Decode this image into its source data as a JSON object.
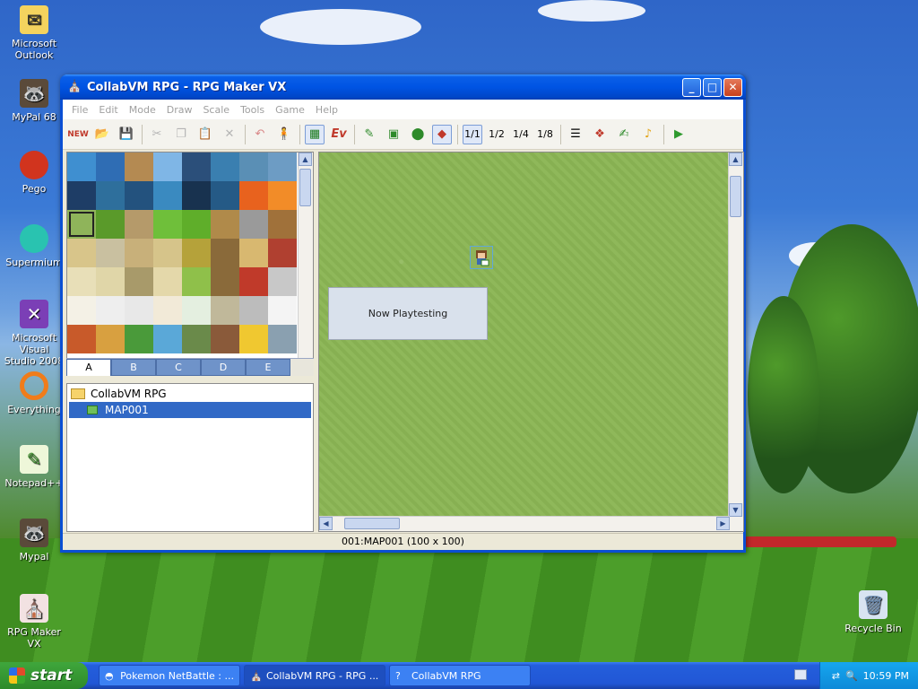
{
  "desktop": {
    "icons": [
      {
        "label": "Microsoft\nOutlook",
        "glyph": "✉",
        "color": "#f4d35e"
      },
      {
        "label": "MyPal 68",
        "glyph": "🦝",
        "color": "#ffffff"
      },
      {
        "label": "Pego",
        "glyph": "●",
        "color": "#d1341e"
      },
      {
        "label": "Supermium",
        "glyph": "●",
        "color": "#29c3b0"
      },
      {
        "label": "Microsoft Visual\nStudio 2008",
        "glyph": "✕",
        "color": "#ffffff"
      },
      {
        "label": "Everything",
        "glyph": "◯",
        "color": "#f07c1a"
      },
      {
        "label": "Notepad++",
        "glyph": "✎",
        "color": "#8bd15a"
      },
      {
        "label": "Mypal",
        "glyph": "🦝",
        "color": "#ffffff"
      },
      {
        "label": "RPG Maker VX",
        "glyph": "⛪",
        "color": "#ffffff"
      }
    ],
    "recycle_bin": "Recycle Bin"
  },
  "window": {
    "title": "CollabVM RPG - RPG Maker VX",
    "menu": [
      "File",
      "Edit",
      "Mode",
      "Draw",
      "Scale",
      "Tools",
      "Game",
      "Help"
    ],
    "toolbar_icons": [
      "new-project-icon",
      "open-project-icon",
      "save-icon",
      "cut-icon",
      "copy-icon",
      "paste-icon",
      "delete-icon",
      "undo-icon",
      "tileset-mode-icon",
      "map-layer-icon",
      "event-layer-icon",
      "pencil-icon",
      "rectangle-icon",
      "ellipse-icon",
      "eraser-icon",
      "scale-1-1-icon",
      "scale-1-2-icon",
      "scale-1-4-icon",
      "scale-1-8-icon",
      "database-icon",
      "material-base-icon",
      "script-editor-icon",
      "sound-test-icon",
      "playtest-icon"
    ],
    "scale_labels": [
      "1/1",
      "1/2",
      "1/4",
      "1/8"
    ],
    "event_label": "Ev",
    "palette_tabs": [
      "A",
      "B",
      "C",
      "D",
      "E"
    ],
    "active_tab": "A",
    "tree": {
      "root": "CollabVM RPG",
      "maps": [
        "MAP001"
      ]
    },
    "map": {
      "overlay_text": "Now Playtesting"
    },
    "status": "001:MAP001 (100 x 100)"
  },
  "taskbar": {
    "start_label": "start",
    "tasks": [
      {
        "label": "Pokemon NetBattle : ...",
        "icon": "pokeball-icon"
      },
      {
        "label": "CollabVM RPG - RPG ...",
        "icon": "rpg-maker-icon"
      },
      {
        "label": "CollabVM RPG",
        "icon": "help-icon"
      }
    ],
    "clock": "10:59 PM"
  }
}
